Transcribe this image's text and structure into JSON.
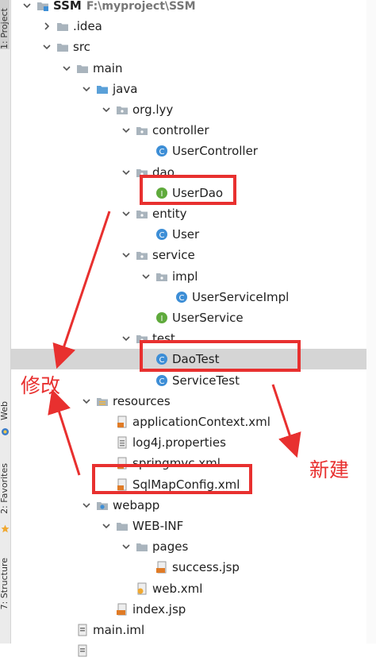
{
  "sidebar": {
    "project_tab": "1: Project",
    "web_tab": "Web",
    "favorites_tab": "2: Favorites",
    "structure_tab": "7: Structure"
  },
  "tree": [
    {
      "label": "SSM",
      "path": "F:\\myproject\\SSM",
      "depth": 0,
      "arrow": "down",
      "icon": "project-folder",
      "bold": true
    },
    {
      "label": ".idea",
      "depth": 1,
      "arrow": "right",
      "icon": "folder"
    },
    {
      "label": "src",
      "depth": 1,
      "arrow": "down",
      "icon": "folder"
    },
    {
      "label": "main",
      "depth": 2,
      "arrow": "down",
      "icon": "folder"
    },
    {
      "label": "java",
      "depth": 3,
      "arrow": "down",
      "icon": "source-folder"
    },
    {
      "label": "org.lyy",
      "depth": 4,
      "arrow": "down",
      "icon": "package"
    },
    {
      "label": "controller",
      "depth": 5,
      "arrow": "down",
      "icon": "package"
    },
    {
      "label": "UserController",
      "depth": 6,
      "arrow": "none",
      "icon": "class"
    },
    {
      "label": "dao",
      "depth": 5,
      "arrow": "down",
      "icon": "package"
    },
    {
      "label": "UserDao",
      "depth": 6,
      "arrow": "none",
      "icon": "interface"
    },
    {
      "label": "entity",
      "depth": 5,
      "arrow": "down",
      "icon": "package"
    },
    {
      "label": "User",
      "depth": 6,
      "arrow": "none",
      "icon": "class"
    },
    {
      "label": "service",
      "depth": 5,
      "arrow": "down",
      "icon": "package"
    },
    {
      "label": "impl",
      "depth": 6,
      "arrow": "down",
      "icon": "package"
    },
    {
      "label": "UserServiceImpl",
      "depth": 7,
      "arrow": "none",
      "icon": "class"
    },
    {
      "label": "UserService",
      "depth": 6,
      "arrow": "none",
      "icon": "interface"
    },
    {
      "label": "test",
      "depth": 5,
      "arrow": "down",
      "icon": "package"
    },
    {
      "label": "DaoTest",
      "depth": 6,
      "arrow": "none",
      "icon": "class",
      "selected": true
    },
    {
      "label": "ServiceTest",
      "depth": 6,
      "arrow": "none",
      "icon": "class"
    },
    {
      "label": "resources",
      "depth": 3,
      "arrow": "down",
      "icon": "resource-folder"
    },
    {
      "label": "applicationContext.xml",
      "depth": 4,
      "arrow": "none",
      "icon": "xml"
    },
    {
      "label": "log4j.properties",
      "depth": 4,
      "arrow": "none",
      "icon": "properties"
    },
    {
      "label": "springmvc.xml",
      "depth": 4,
      "arrow": "none",
      "icon": "xml"
    },
    {
      "label": "SqlMapConfig.xml",
      "depth": 4,
      "arrow": "none",
      "icon": "xml"
    },
    {
      "label": "webapp",
      "depth": 3,
      "arrow": "down",
      "icon": "web-folder"
    },
    {
      "label": "WEB-INF",
      "depth": 4,
      "arrow": "down",
      "icon": "folder"
    },
    {
      "label": "pages",
      "depth": 5,
      "arrow": "down",
      "icon": "folder"
    },
    {
      "label": "success.jsp",
      "depth": 6,
      "arrow": "none",
      "icon": "jsp"
    },
    {
      "label": "web.xml",
      "depth": 5,
      "arrow": "none",
      "icon": "webxml"
    },
    {
      "label": "index.jsp",
      "depth": 4,
      "arrow": "none",
      "icon": "jsp"
    },
    {
      "label": "main.iml",
      "depth": 2,
      "arrow": "none",
      "icon": "iml"
    },
    {
      "label": "",
      "depth": 2,
      "arrow": "none",
      "icon": "iml"
    }
  ],
  "annotations": {
    "modify": "修改",
    "create": "新建"
  },
  "colors": {
    "annotation_red": "#e8302f",
    "selection": "#d5d5d5",
    "class_icon": "#3d8ed6",
    "interface_icon": "#5faa3c",
    "folder": "#a9b4bd",
    "source_folder": "#5aa0d8"
  }
}
